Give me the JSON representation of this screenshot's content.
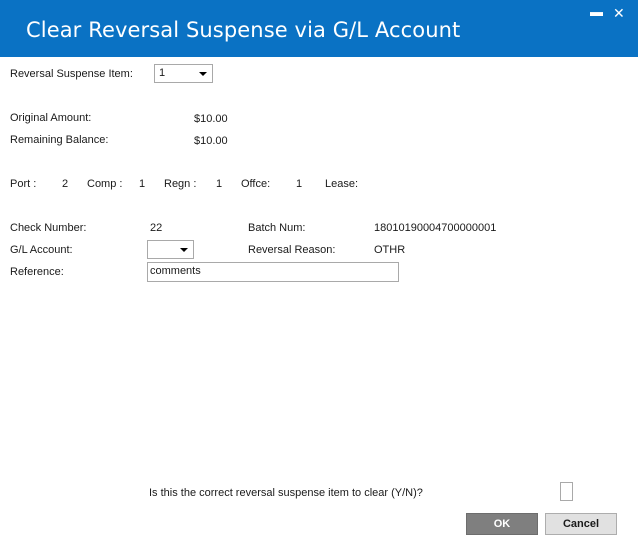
{
  "window": {
    "title": "Clear Reversal Suspense via G/L Account",
    "minimize": "▬",
    "close": "✕"
  },
  "suspense_item": {
    "label": "Reversal  Suspense Item:",
    "value": "1"
  },
  "amounts": {
    "original_label": "Original Amount:",
    "original_value": "$10.00",
    "remaining_label": "Remaining Balance:",
    "remaining_value": "$10.00"
  },
  "location": {
    "port_label": "Port :",
    "port_value": "2",
    "comp_label": "Comp :",
    "comp_value": "1",
    "regn_label": "Regn :",
    "regn_value": "1",
    "offce_label": "Offce:",
    "offce_value": "1",
    "lease_label": "Lease:"
  },
  "details": {
    "check_label": "Check Number:",
    "check_value": "22",
    "batch_label": "Batch Num:",
    "batch_value": "18010190004700000001",
    "gl_label": "G/L Account:",
    "gl_value": "",
    "reason_label": "Reversal Reason:",
    "reason_value": "OTHR",
    "reference_label": "Reference:",
    "reference_value": "comments"
  },
  "confirm": {
    "question": "Is this the correct reversal suspense item to clear (Y/N)?",
    "answer": ""
  },
  "buttons": {
    "ok": "OK",
    "cancel": "Cancel"
  },
  "colors": {
    "titlebar": "#0a72c4",
    "ok_button": "#7f7f7f",
    "cancel_button": "#e1e1e1"
  }
}
